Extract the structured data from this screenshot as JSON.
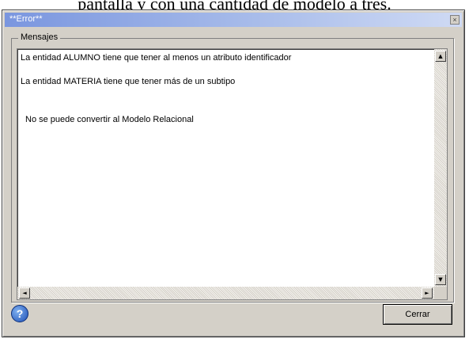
{
  "background_caption": "pantalla y con una cantidad de modelo a tres.",
  "window": {
    "title": "**Error**",
    "title_close_glyph": "×"
  },
  "group": {
    "legend": "Mensajes"
  },
  "messages": [
    "La entidad ALUMNO tiene que tener al menos un atributo identificador",
    "La entidad MATERIA tiene que tener más de un subtipo",
    "No se puede convertir al Modelo Relacional"
  ],
  "scrollbar": {
    "up": "▲",
    "down": "▼",
    "left": "◄",
    "right": "►"
  },
  "buttons": {
    "help_label": "?",
    "close_label": "Cerrar"
  },
  "colors": {
    "dialog_face": "#d4d0c8",
    "titlebar_start": "#7a96df",
    "titlebar_end": "#cfdaf4",
    "help_icon": "#1e4fb5"
  }
}
